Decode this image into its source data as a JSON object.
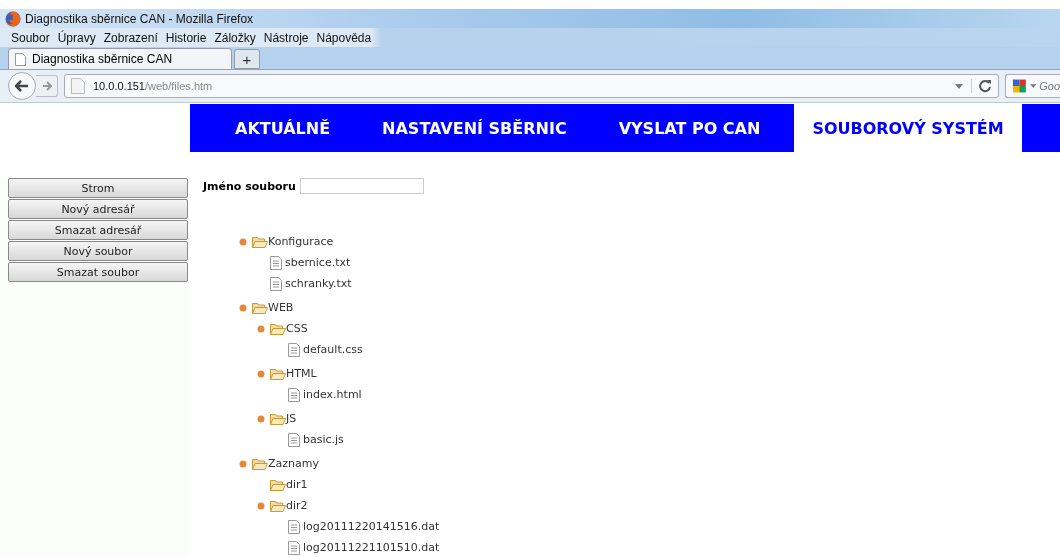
{
  "window": {
    "title": "Diagnostika sběrnice CAN - Mozilla Firefox"
  },
  "menu": [
    "Soubor",
    "Úpravy",
    "Zobrazení",
    "Historie",
    "Záložky",
    "Nástroje",
    "Nápověda"
  ],
  "tabs": [
    {
      "label": "Diagnostika sběrnice CAN",
      "selected": true
    }
  ],
  "new_tab": "+",
  "address": {
    "host": "10.0.0.151",
    "path": "/web/files.htm"
  },
  "search": {
    "placeholder": "Goo"
  },
  "nav": [
    {
      "label": "AKTUÁLNĚ",
      "selected": false
    },
    {
      "label": "NASTAVENÍ SBĚRNIC",
      "selected": false
    },
    {
      "label": "VYSLAT PO CAN",
      "selected": false
    },
    {
      "label": "SOUBOROVÝ SYSTÉM",
      "selected": true
    }
  ],
  "sidebar": {
    "buttons": [
      "Strom",
      "Nový adresář",
      "Smazat adresář",
      "Nový soubor",
      "Smazat soubor"
    ]
  },
  "filename": {
    "label": "Jméno souboru"
  },
  "tree": [
    {
      "kind": "folder",
      "name": "Konfigurace",
      "children": [
        {
          "kind": "file",
          "name": "sbernice.txt"
        },
        {
          "kind": "file",
          "name": "schranky.txt"
        }
      ]
    },
    {
      "kind": "folder",
      "name": "WEB",
      "children": [
        {
          "kind": "folder",
          "name": "CSS",
          "children": [
            {
              "kind": "file",
              "name": "default.css"
            }
          ]
        },
        {
          "kind": "folder",
          "name": "HTML",
          "children": [
            {
              "kind": "file",
              "name": "index.html"
            }
          ]
        },
        {
          "kind": "folder",
          "name": "JS",
          "children": [
            {
              "kind": "file",
              "name": "basic.js"
            }
          ]
        }
      ]
    },
    {
      "kind": "folder",
      "name": "Zaznamy",
      "children": [
        {
          "kind": "folder",
          "name": "dir1"
        },
        {
          "kind": "folder",
          "name": "dir2",
          "children": [
            {
              "kind": "file",
              "name": "log20111220141516.dat"
            },
            {
              "kind": "file",
              "name": "log20111221101510.dat"
            }
          ]
        }
      ]
    }
  ]
}
